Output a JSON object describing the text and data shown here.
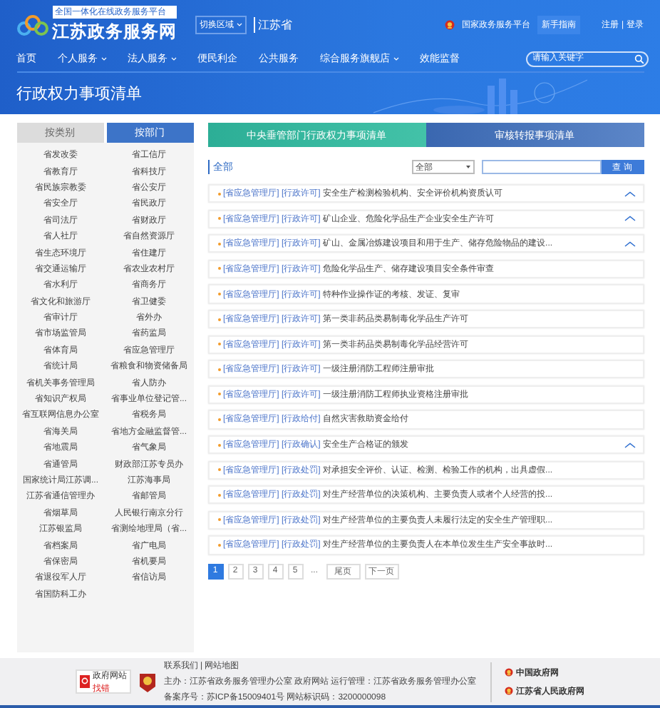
{
  "header": {
    "logo_tag": "全国一体化在线政务服务平台",
    "logo_title": "江苏政务服务网",
    "region_select": "切换区域",
    "region": "江苏省",
    "national_platform": "国家政务服务平台",
    "guide_button": "新手指南",
    "register": "注册",
    "separator": "|",
    "login": "登录"
  },
  "nav": [
    {
      "label": "首页",
      "dropdown": false
    },
    {
      "label": "个人服务",
      "dropdown": true
    },
    {
      "label": "法人服务",
      "dropdown": true
    },
    {
      "label": "便民利企",
      "dropdown": false
    },
    {
      "label": "公共服务",
      "dropdown": false
    },
    {
      "label": "综合服务旗舰店",
      "dropdown": true
    },
    {
      "label": "效能监督",
      "dropdown": false
    }
  ],
  "search": {
    "placeholder": "请输入关键字"
  },
  "banner": {
    "title": "行政权力事项清单"
  },
  "sidebar": {
    "tabs": [
      {
        "label": "按类别",
        "selected": false
      },
      {
        "label": "按部门",
        "selected": true
      }
    ],
    "departments": [
      "省发改委",
      "省工信厅",
      "省教育厅",
      "省科技厅",
      "省民族宗教委",
      "省公安厅",
      "省安全厅",
      "省民政厅",
      "省司法厅",
      "省财政厅",
      "省人社厅",
      "省自然资源厅",
      "省生态环境厅",
      "省住建厅",
      "省交通运输厅",
      "省农业农村厅",
      "省水利厅",
      "省商务厅",
      "省文化和旅游厅",
      "省卫健委",
      "省审计厅",
      "省外办",
      "省市场监管局",
      "省药监局",
      "省体育局",
      "省应急管理厅",
      "省统计局",
      "省粮食和物资储备局",
      "省机关事务管理局",
      "省人防办",
      "省知识产权局",
      "省事业单位登记管...",
      "省互联网信息办公室",
      "省税务局",
      "省海关局",
      "省地方金融监督管...",
      "省地震局",
      "省气象局",
      "省通管局",
      "财政部江苏专员办",
      "国家统计局江苏调...",
      "江苏海事局",
      "江苏省通信管理办",
      "省邮管局",
      "省烟草局",
      "人民银行南京分行",
      "江苏银监局",
      "省测绘地理局（省...",
      "省档案局",
      "省广电局",
      "省保密局",
      "省机要局",
      "省退役军人厅",
      "省信访局",
      "省国防科工办"
    ]
  },
  "tabs": [
    {
      "label": "中央垂管部门行政权力事项清单",
      "selected": true
    },
    {
      "label": "审核转报事项清单",
      "selected": false
    }
  ],
  "filter": {
    "heading": "全部",
    "select": "全部",
    "button": "查 询"
  },
  "items": [
    {
      "department": "[省应急管理厅]",
      "type": "[行政许可]",
      "title": "安全生产检测检验机构、安全评价机构资质认可",
      "expandable": true
    },
    {
      "department": "[省应急管理厅]",
      "type": "[行政许可]",
      "title": "矿山企业、危险化学品生产企业安全生产许可",
      "expandable": true
    },
    {
      "department": "[省应急管理厅]",
      "type": "[行政许可]",
      "title": "矿山、金属冶炼建设项目和用于生产、储存危险物品的建设...",
      "expandable": true
    },
    {
      "department": "[省应急管理厅]",
      "type": "[行政许可]",
      "title": "危险化学品生产、储存建设项目安全条件审查",
      "expandable": false
    },
    {
      "department": "[省应急管理厅]",
      "type": "[行政许可]",
      "title": "特种作业操作证的考核、发证、复审",
      "expandable": false
    },
    {
      "department": "[省应急管理厅]",
      "type": "[行政许可]",
      "title": "第一类非药品类易制毒化学品生产许可",
      "expandable": false
    },
    {
      "department": "[省应急管理厅]",
      "type": "[行政许可]",
      "title": "第一类非药品类易制毒化学品经营许可",
      "expandable": false
    },
    {
      "department": "[省应急管理厅]",
      "type": "[行政许可]",
      "title": "一级注册消防工程师注册审批",
      "expandable": false
    },
    {
      "department": "[省应急管理厅]",
      "type": "[行政许可]",
      "title": "一级注册消防工程师执业资格注册审批",
      "expandable": false
    },
    {
      "department": "[省应急管理厅]",
      "type": "[行政给付]",
      "title": "自然灾害救助资金给付",
      "expandable": false
    },
    {
      "department": "[省应急管理厅]",
      "type": "[行政确认]",
      "title": "安全生产合格证的颁发",
      "expandable": true
    },
    {
      "department": "[省应急管理厅]",
      "type": "[行政处罚]",
      "title": "对承担安全评价、认证、检测、检验工作的机构，出具虚假...",
      "expandable": false
    },
    {
      "department": "[省应急管理厅]",
      "type": "[行政处罚]",
      "title": "对生产经营单位的决策机构、主要负责人或者个人经营的投...",
      "expandable": false
    },
    {
      "department": "[省应急管理厅]",
      "type": "[行政处罚]",
      "title": "对生产经营单位的主要负责人未履行法定的安全生产管理职...",
      "expandable": false
    },
    {
      "department": "[省应急管理厅]",
      "type": "[行政处罚]",
      "title": "对生产经营单位的主要负责人在本单位发生生产安全事故时...",
      "expandable": false
    }
  ],
  "pagination": [
    {
      "label": "1",
      "selected": true
    },
    {
      "label": "2",
      "selected": false
    },
    {
      "label": "3",
      "selected": false
    },
    {
      "label": "4",
      "selected": false
    },
    {
      "label": "5",
      "selected": false
    },
    {
      "label": "...",
      "kind": "gap"
    },
    {
      "label": "尾页",
      "selected": false
    },
    {
      "label": "下一页",
      "selected": false
    }
  ],
  "footer": {
    "badge_top": "政府网站",
    "badge_bottom": "找错",
    "links": "联系我们 | 网站地图",
    "sponsor": "主办：江苏省政务服务管理办公室 政府网站 运行管理：江苏省政务服务管理办公室",
    "record": "备案序号：苏ICP备15009401号   网站标识码：3200000098",
    "right_links": [
      "中国政府网",
      "江苏省人民政府网"
    ]
  }
}
